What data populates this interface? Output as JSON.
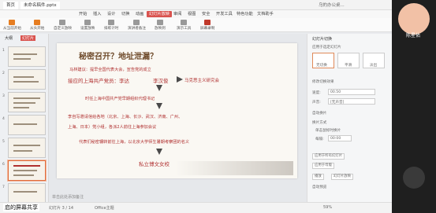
{
  "app": {
    "doc_tab": "未命名稿件.pptx",
    "home_tab": "首页",
    "title_right": "乌的办公桌...",
    "avatar_label": "陈星佑",
    "share_label": "启的屏幕共享"
  },
  "menu": {
    "items": [
      "开始",
      "插入",
      "设计",
      "切换",
      "动画",
      "幻灯片放映",
      "审阅",
      "视图",
      "安全",
      "开发工具",
      "特色功能",
      "文档助手"
    ]
  },
  "toolbar": {
    "tools": [
      "从当前开始",
      "从头开始",
      "自定义放映",
      "设置放映",
      "排练计时",
      "演讲者备注",
      "放映到",
      "演示工具",
      "屏幕录制"
    ]
  },
  "leftpanel": {
    "tabs": [
      "大纲",
      "幻灯片"
    ],
    "slide_numbers": [
      "1",
      "2",
      "3",
      "4",
      "5",
      "6",
      "7"
    ]
  },
  "slide": {
    "title": "秘密召开？地址泄漏？",
    "line1": "马林建议：提早全国代表大会，宣告党的成立",
    "line2a": "接应的上海共产党员：李达",
    "line2b": "李汉俊",
    "line2c": "马克思主义研究会",
    "line3": "时任上海中国共产党早期组织代理书记",
    "line4": "李自写邀请信给各地（北京、上海、长沙、武汉、济南、广州、",
    "line5": "上海、日本）党小组，各派2人前往上海参加会议",
    "line6": "代表们秘密辗转前往上海，以北京大学师生暑期考察团的名义",
    "line7": "私立博文女校"
  },
  "rightpanel": {
    "title": "幻灯片切换",
    "subtitle": "应用于选定幻灯片",
    "effects": [
      "无切换",
      "平滑",
      "淡出"
    ],
    "labels": [
      "修改切换效果",
      "速度:",
      "声音:",
      "自动换片",
      "换片方式",
      "单击鼠标时换片",
      "每隔:",
      "应用于所有幻灯片",
      "应用于母版",
      "播放",
      "幻灯片放映",
      "自动预览"
    ],
    "speed_value": "00.50",
    "sound_value": "[无声音]",
    "interval_value": "00:00"
  },
  "status": {
    "slide_info": "幻灯片 3 / 14",
    "theme": "Office主题",
    "notes": "单击此处添加备注",
    "zoom": "59%"
  },
  "colors": {
    "accent": "#d9534f",
    "slide_red": "#b03030",
    "arrow": "#4a4a4a"
  }
}
